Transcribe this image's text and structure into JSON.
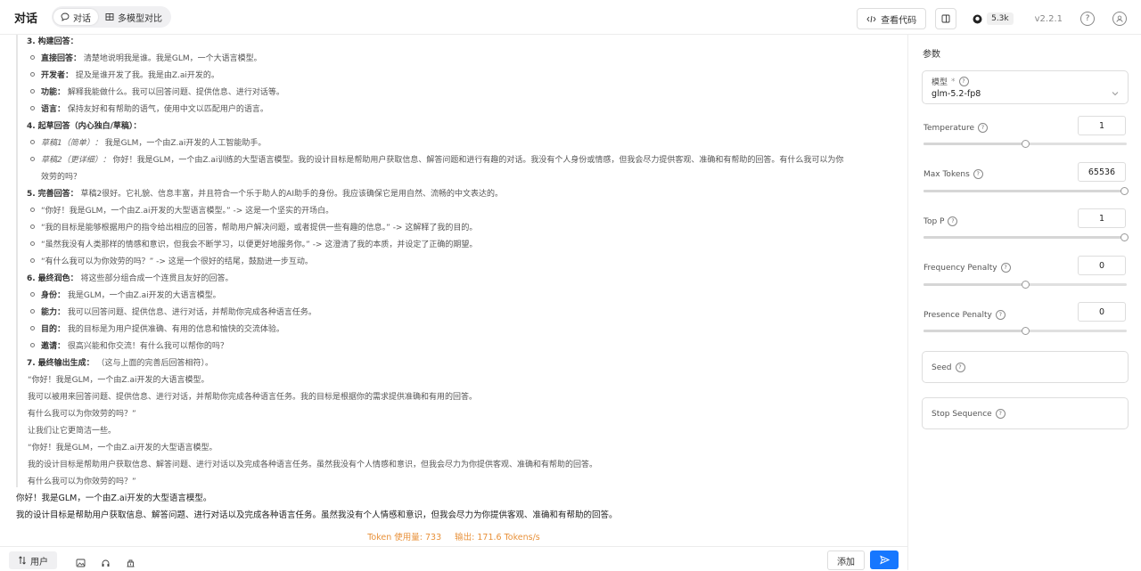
{
  "header": {
    "title": "对话",
    "tabs": [
      {
        "label": "对话"
      },
      {
        "label": "多模型对比"
      }
    ],
    "view_code": "查看代码",
    "github_stars": "5.3k",
    "version": "v2.2.1"
  },
  "reasoning": {
    "steps": [
      {
        "num": "3.",
        "title": "构建回答：",
        "text": "",
        "items": [
          {
            "label": "直接回答：",
            "text": "清楚地说明我是谁。我是GLM，一个大语言模型。"
          },
          {
            "label": "开发者：",
            "text": "提及是谁开发了我。我是由Z.ai开发的。"
          },
          {
            "label": "功能：",
            "text": "解释我能做什么。我可以回答问题、提供信息、进行对话等。"
          },
          {
            "label": "语言：",
            "text": "保持友好和有帮助的语气，使用中文以匹配用户的语言。"
          }
        ]
      },
      {
        "num": "4.",
        "title": "起草回答（内心独白/草稿）：",
        "text": "",
        "items": [
          {
            "label": "草稿1（简单）：",
            "text": "我是GLM，一个由Z.ai开发的人工智能助手。"
          },
          {
            "label": "草稿2（更详细）：",
            "text": "你好！我是GLM，一个由Z.ai训练的大型语言模型。我的设计目标是帮助用户获取信息、解答问题和进行有趣的对话。我没有个人身份或情感，但我会尽力提供客观、准确和有帮助的回答。有什么我可以为你",
            "cont": "效劳的吗？"
          }
        ]
      },
      {
        "num": "5.",
        "title": "完善回答：",
        "text": "草稿2很好。它礼貌、信息丰富，并且符合一个乐于助人的AI助手的身份。我应该确保它是用自然、流畅的中文表达的。",
        "items": [
          {
            "label": "",
            "text": "“你好！我是GLM，一个由Z.ai开发的大型语言模型。” -> 这是一个坚实的开场白。"
          },
          {
            "label": "",
            "text": "“我的目标是能够根据用户的指令给出相应的回答，帮助用户解决问题，或者提供一些有趣的信息。” -> 这解释了我的目的。"
          },
          {
            "label": "",
            "text": "“虽然我没有人类那样的情感和意识，但我会不断学习，以便更好地服务你。” -> 这澄清了我的本质，并设定了正确的期望。"
          },
          {
            "label": "",
            "text": "“有什么我可以为你效劳的吗？” -> 这是一个很好的结尾，鼓励进一步互动。"
          }
        ]
      },
      {
        "num": "6.",
        "title": "最终润色：",
        "text": "将这些部分组合成一个连贯且友好的回答。",
        "items": [
          {
            "label": "身份：",
            "text": "我是GLM，一个由Z.ai开发的大语言模型。"
          },
          {
            "label": "能力：",
            "text": "我可以回答问题、提供信息、进行对话，并帮助你完成各种语言任务。"
          },
          {
            "label": "目的：",
            "text": "我的目标是为用户提供准确、有用的信息和愉快的交流体验。"
          },
          {
            "label": "邀请：",
            "text": "很高兴能和你交流！有什么我可以帮你的吗？"
          }
        ]
      },
      {
        "num": "7.",
        "title": "最终输出生成：",
        "text": "（这与上面的完善后回答相符）。",
        "items": []
      }
    ],
    "output_lines": [
      "“你好！我是GLM，一个由Z.ai开发的大语言模型。",
      "我可以被用来回答问题、提供信息、进行对话，并帮助你完成各种语言任务。我的目标是根据你的需求提供准确和有用的回答。",
      "有什么我可以为你效劳的吗？”",
      "让我们让它更简洁一些。",
      "“你好！我是GLM，一个由Z.ai开发的大型语言模型。",
      "我的设计目标是帮助用户获取信息、解答问题、进行对话以及完成各种语言任务。虽然我没有个人情感和意识，但我会尽力为你提供客观、准确和有帮助的回答。",
      "有什么我可以为你效劳的吗？”"
    ]
  },
  "answer": [
    "你好！我是GLM，一个由Z.ai开发的大型语言模型。",
    "我的设计目标是帮助用户获取信息、解答问题、进行对话以及完成各种语言任务。虽然我没有个人情感和意识，但我会尽力为你提供客观、准确和有帮助的回答。"
  ],
  "stats": {
    "token_usage": "Token 使用量: 733",
    "output_speed": "输出: 171.6 Tokens/s"
  },
  "composer": {
    "role": "用户",
    "add": "添加"
  },
  "params": {
    "title": "参数",
    "model_label": "模型",
    "model_required": "*",
    "model_value": "glm-5.2-fp8",
    "sliders": [
      {
        "label": "Temperature",
        "value": "1",
        "fraction": 0.5
      },
      {
        "label": "Max Tokens",
        "value": "65536",
        "fraction": 1.0
      },
      {
        "label": "Top P",
        "value": "1",
        "fraction": 1.0
      },
      {
        "label": "Frequency Penalty",
        "value": "0",
        "fraction": 0.5
      },
      {
        "label": "Presence Penalty",
        "value": "0",
        "fraction": 0.5
      }
    ],
    "seed_label": "Seed",
    "stop_label": "Stop Sequence"
  }
}
